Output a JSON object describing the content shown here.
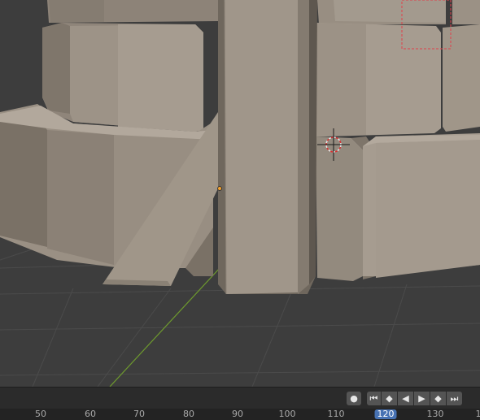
{
  "viewport": {
    "background": "#3d3d3d",
    "grid_color": "#4a4a4a",
    "axis_y_color": "#6e9a2e",
    "mesh_color": "#a49a8e",
    "selection_color": "#e0404a",
    "origin_color": "#f0a030"
  },
  "timeline": {
    "controls": {
      "keyframe_dot": "●",
      "jump_start": "⏮",
      "prev_keyframe": "◆",
      "play_reverse": "◀",
      "play": "▶",
      "next_keyframe": "◆",
      "jump_end": "⏭"
    },
    "ruler": {
      "labels": [
        "50",
        "60",
        "70",
        "80",
        "90",
        "100",
        "110",
        "120",
        "130",
        "1"
      ],
      "current_frame": "120"
    }
  }
}
